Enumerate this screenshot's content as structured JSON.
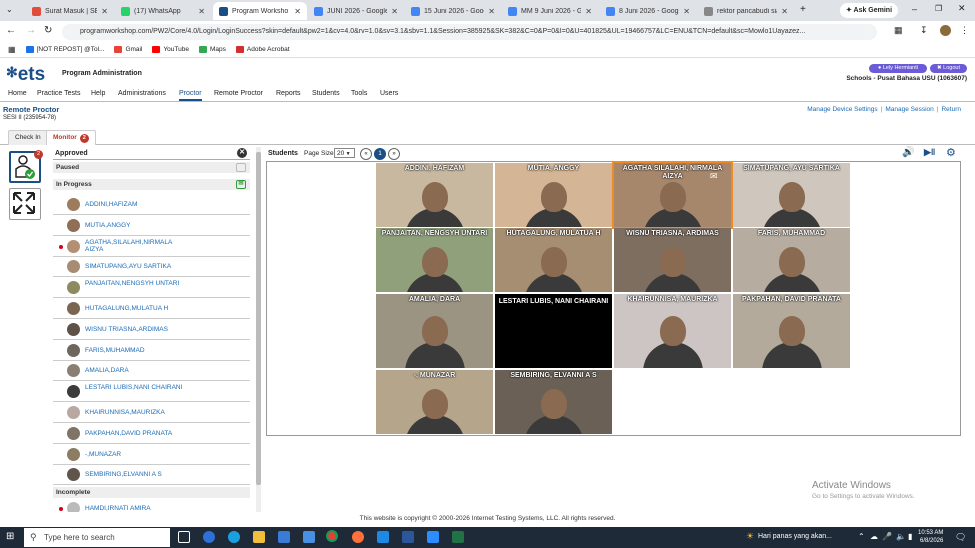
{
  "browser": {
    "tabs": [
      {
        "title": "Surat Masuk | SEFTIA",
        "color": "#e04d3a"
      },
      {
        "title": "(17) WhatsApp",
        "color": "#25d366"
      },
      {
        "title": "Program Worksho",
        "color": "#1a4e86"
      },
      {
        "title": "JUNI 2026 - Google D",
        "color": "#4285f4"
      },
      {
        "title": "15 Juni 2026 - Goog",
        "color": "#4285f4"
      },
      {
        "title": "MM 9 Juni 2026 - Goo",
        "color": "#4285f4"
      },
      {
        "title": "8 Juni 2026 - Google",
        "color": "#4285f4"
      },
      {
        "title": "rektor pancabudi siap",
        "color": "#888888"
      }
    ],
    "ask_gemini": "Ask Gemini",
    "url": "programworkshop.com/PW2/Core/4.0/Login/LoginSuccess?skin=default&pw2=1&cv=4.0&rv=1.0&sv=3.1&sbv=1.1&Session=385925&SK=382&C=0&P=0&I=0&U=401825&UL=19466757&LC=ENU&TCN=default&sc=Mowlo1Uayazez...",
    "bookmarks": [
      "[NOT REPOST] @Tol...",
      "Gmail",
      "YouTube",
      "Maps",
      "Adobe Acrobat"
    ]
  },
  "header": {
    "logo": "ets",
    "program": "Program Administration",
    "user": "Lely Hermianti",
    "logout": "Logout",
    "school": "Schools - Pusat Bahasa USU (1063607)"
  },
  "nav": [
    "Home",
    "Practice Tests",
    "Help",
    "Administrations",
    "Proctor",
    "Remote Proctor",
    "Reports",
    "Students",
    "Tools",
    "Users"
  ],
  "page": {
    "title": "Remote Proctor",
    "session": "SESI II (235954-78)",
    "links": [
      "Manage Device Settings",
      "Manage Session",
      "Return"
    ]
  },
  "subtabs": {
    "checkin": "Check In",
    "monitor": "Monitor",
    "monitor_count": "2"
  },
  "side_badge": "2",
  "panel": {
    "approved": "Approved",
    "paused": "Paused",
    "in_progress": "In Progress",
    "incomplete": "Incomplete",
    "students": [
      {
        "name": "ADDINI,HAFIZAM",
        "alert": false
      },
      {
        "name": "MUTIA,ANGGY",
        "alert": false
      },
      {
        "name": "AGATHA,SILALAHI,NIRMALA AIZYA",
        "alert": true
      },
      {
        "name": "SIMATUPANG,AYU SARTIKA",
        "alert": false
      },
      {
        "name": "PANJAITAN,NENGSYH UNTARI",
        "alert": false
      },
      {
        "name": "HUTAGALUNG,MULATUA H",
        "alert": false
      },
      {
        "name": "WISNU TRIASNA,ARDIMAS",
        "alert": false
      },
      {
        "name": "FARIS,MUHAMMAD",
        "alert": false
      },
      {
        "name": "AMALIA,DARA",
        "alert": false
      },
      {
        "name": "LESTARI LUBIS,NANI CHAIRANI",
        "alert": false
      },
      {
        "name": "KHAIRUNNISA,MAURIZKA",
        "alert": false
      },
      {
        "name": "PAKPAHAN,DAVID PRANATA",
        "alert": false
      },
      {
        "name": "-,MUNAZAR",
        "alert": false
      },
      {
        "name": "SEMBIRING,ELVANNI A S",
        "alert": false
      }
    ],
    "incomplete_students": [
      {
        "name": "HAMDI,IRNATI AMIRA",
        "alert": true
      }
    ]
  },
  "grid": {
    "students_label": "Students",
    "page_size_label": "Page Size:",
    "page_size": "20",
    "current_page": "1",
    "tiles": [
      {
        "name": "ADDINI, HAFIZAM",
        "bg": "#c9b8a0",
        "dark": false
      },
      {
        "name": "MUTIA, ANGGY",
        "bg": "#d4b595",
        "dark": false
      },
      {
        "name": "AGATHA SILALAHI, NIRMALA AIZYA",
        "bg": "#a7876c",
        "dark": false
      },
      {
        "name": "SIMATUPANG, AYU SARTIKA",
        "bg": "#cfc6bd",
        "dark": false
      },
      {
        "name": "PANJAITAN, NENGSYH UNTARI",
        "bg": "#8fa07a",
        "dark": false
      },
      {
        "name": "HUTAGALUNG, MULATUA H",
        "bg": "#a68e72",
        "dark": false
      },
      {
        "name": "WISNU TRIASNA, ARDIMAS",
        "bg": "#7e6e60",
        "dark": false
      },
      {
        "name": "FARIS, MUHAMMAD",
        "bg": "#b6aca0",
        "dark": false
      },
      {
        "name": "AMALIA, DARA",
        "bg": "#9c9482",
        "dark": false
      },
      {
        "name": "LESTARI LUBIS, NANI CHAIRANI",
        "bg": "#000000",
        "dark": true
      },
      {
        "name": "KHAIRUNNISA, MAURIZKA",
        "bg": "#cdc5c3",
        "dark": false
      },
      {
        "name": "PAKPAHAN, DAVID PRANATA",
        "bg": "#b3aa9c",
        "dark": false
      },
      {
        "name": "-, MUNAZAR",
        "bg": "#b5a58a",
        "dark": false
      },
      {
        "name": "SEMBIRING, ELVANNI A S",
        "bg": "#6b6055",
        "dark": false
      }
    ]
  },
  "footer": "This website is copyright © 2000-2026 Internet Testing Systems, LLC. All rights reserved.",
  "watermark": {
    "title": "Activate Windows",
    "sub": "Go to Settings to activate Windows."
  },
  "taskbar": {
    "search": "Type here to search",
    "weather": "Hari panas yang akan...",
    "time": "10:53 AM",
    "date": "6/8/2026"
  }
}
